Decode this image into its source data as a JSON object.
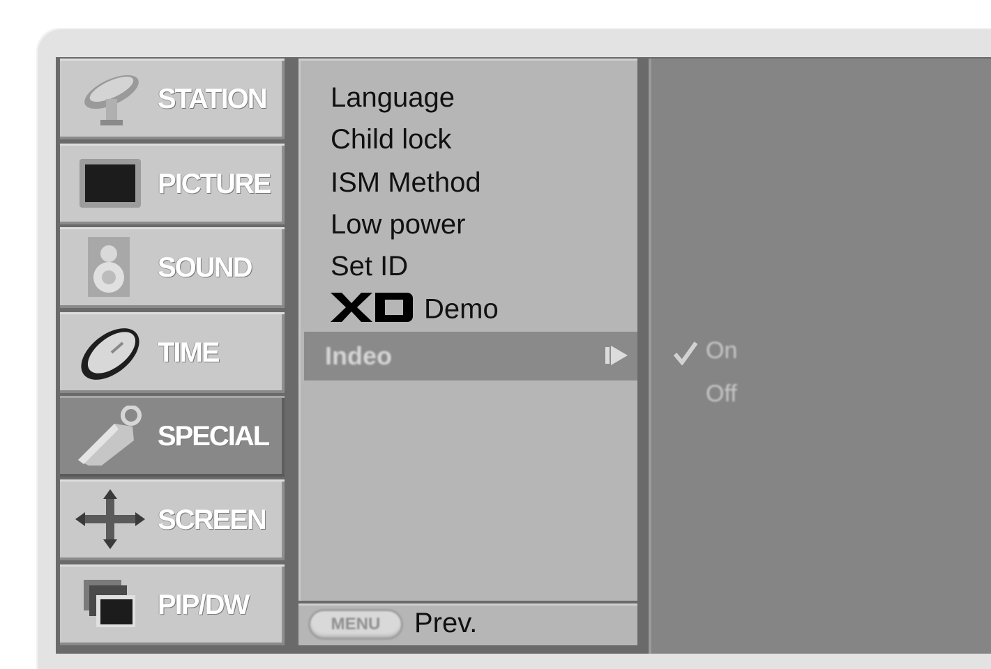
{
  "categories": [
    {
      "label": "STATION",
      "icon": "satellite-dish-icon",
      "active": false
    },
    {
      "label": "PICTURE",
      "icon": "tv-screen-icon",
      "active": false
    },
    {
      "label": "SOUND",
      "icon": "speaker-icon",
      "active": false
    },
    {
      "label": "TIME",
      "icon": "clock-icon",
      "active": false
    },
    {
      "label": "SPECIAL",
      "icon": "tag-icon",
      "active": true
    },
    {
      "label": "SCREEN",
      "icon": "move-arrows-icon",
      "active": false
    },
    {
      "label": "PIP/DW",
      "icon": "pip-windows-icon",
      "active": false
    }
  ],
  "submenu": {
    "items": [
      "Language",
      "Child lock",
      "ISM Method",
      "Low power",
      "Set ID"
    ],
    "xd_demo_label": "Demo",
    "highlighted_item": "Indeo",
    "xd_logo_text": "XD"
  },
  "options": {
    "items": [
      "On",
      "Off"
    ],
    "checked": "On"
  },
  "footer": {
    "menu_button_label": "MENU",
    "prev_label": "Prev."
  },
  "colors": {
    "frame": "#e3e3e3",
    "category_bg": "#c9c9c9",
    "category_active_bg": "#888888",
    "submenu_bg": "#b6b6b6",
    "highlight_bg": "#8a8a8a",
    "options_bg": "#858585"
  }
}
